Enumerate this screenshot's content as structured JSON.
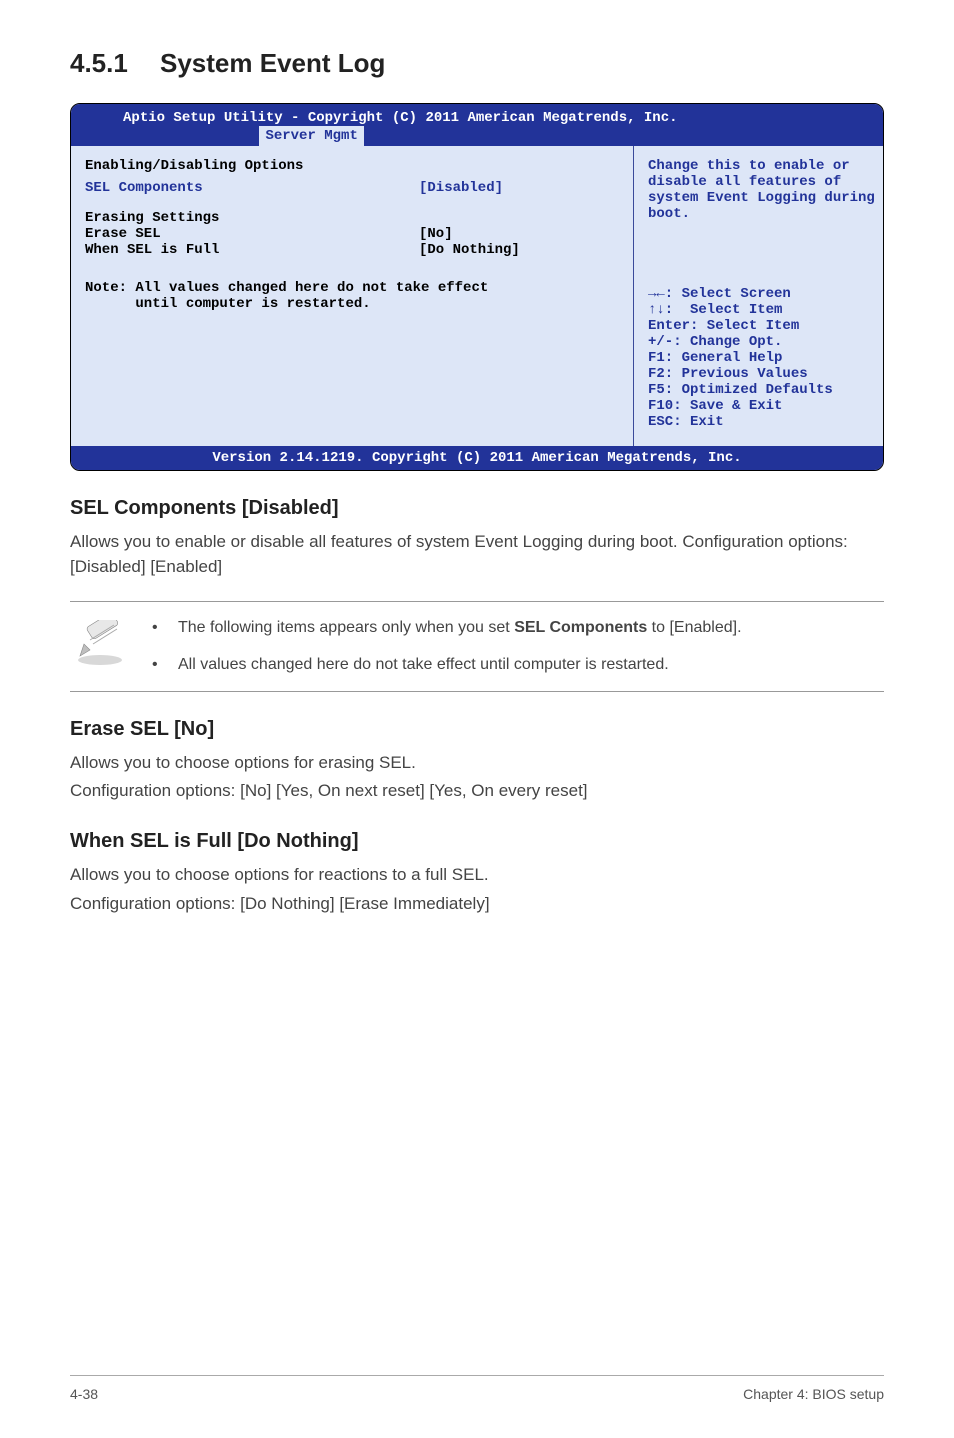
{
  "heading": {
    "number": "4.5.1",
    "title": "System Event Log"
  },
  "bios": {
    "header_line": "Aptio Setup Utility - Copyright (C) 2011 American Megatrends, Inc.",
    "tab": "Server Mgmt",
    "left": {
      "group1_label": "Enabling/Disabling Options",
      "sel_components_label": "SEL Components",
      "sel_components_value": "[Disabled]",
      "group2_label": "Erasing Settings",
      "erase_sel_label": "Erase SEL",
      "erase_sel_value": "[No]",
      "when_full_label": "When SEL is Full",
      "when_full_value": "[Do Nothing]",
      "note_line1": "Note: All values changed here do not take effect",
      "note_line2": "      until computer is restarted."
    },
    "right": {
      "desc1": "Change this to enable or",
      "desc2": "disable all features of",
      "desc3": "system Event Logging during",
      "desc4": "boot.",
      "h1": "→←: Select Screen",
      "h2": "↑↓:  Select Item",
      "h3": "Enter: Select Item",
      "h4": "+/-: Change Opt.",
      "h5": "F1: General Help",
      "h6": "F2: Previous Values",
      "h7": "F5: Optimized Defaults",
      "h8": "F10: Save & Exit",
      "h9": "ESC: Exit"
    },
    "footer": "Version 2.14.1219. Copyright (C) 2011 American Megatrends, Inc."
  },
  "sections": {
    "sel_components": {
      "title": "SEL Components [Disabled]",
      "p1": "Allows you to enable or disable all features of system Event Logging during boot. Configuration options: [Disabled] [Enabled]"
    },
    "callout": {
      "item1_pre": "The following items appears only when you set ",
      "item1_bold": "SEL Components",
      "item1_post": " to [Enabled].",
      "item2": "All values changed here do not take effect until computer is restarted."
    },
    "erase_sel": {
      "title": "Erase SEL [No]",
      "p1": "Allows you to choose options for erasing SEL.",
      "p2": "Configuration options: [No] [Yes, On next reset] [Yes, On every reset]"
    },
    "when_full": {
      "title": "When SEL is Full [Do Nothing]",
      "p1": "Allows you to choose options for reactions to a full SEL.",
      "p2": "Configuration options: [Do Nothing] [Erase Immediately]"
    }
  },
  "footer": {
    "left": "4-38",
    "right": "Chapter 4: BIOS setup"
  }
}
